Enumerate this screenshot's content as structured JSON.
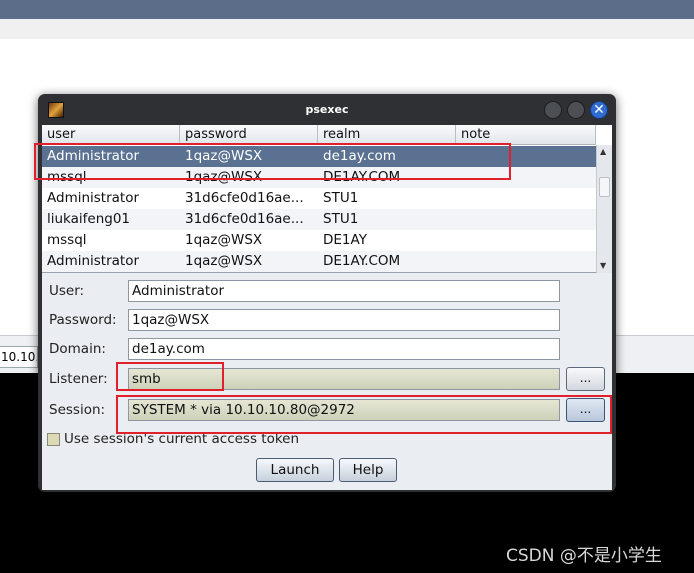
{
  "background": {
    "tab_partial": "10.10.",
    "watermark": "CSDN @不是小学生"
  },
  "dialog": {
    "title": "psexec",
    "close_glyph": "✕",
    "table": {
      "columns": [
        "user",
        "password",
        "realm",
        "note"
      ],
      "rows": [
        {
          "user": "Administrator",
          "password": "1qaz@WSX",
          "realm": "de1ay.com",
          "note": ""
        },
        {
          "user": "mssql",
          "password": "1qaz@WSX",
          "realm": "DE1AY.COM",
          "note": ""
        },
        {
          "user": "Administrator",
          "password": "31d6cfe0d16ae...",
          "realm": "STU1",
          "note": ""
        },
        {
          "user": "liukaifeng01",
          "password": "31d6cfe0d16ae...",
          "realm": "STU1",
          "note": ""
        },
        {
          "user": "mssql",
          "password": "1qaz@WSX",
          "realm": "DE1AY",
          "note": ""
        },
        {
          "user": "Administrator",
          "password": "1qaz@WSX",
          "realm": "DE1AY.COM",
          "note": ""
        }
      ],
      "selected_row": 0
    },
    "form": {
      "user_label": "User:",
      "user_value": "Administrator",
      "password_label": "Password:",
      "password_value": "1qaz@WSX",
      "domain_label": "Domain:",
      "domain_value": "de1ay.com",
      "listener_label": "Listener:",
      "listener_value": "smb",
      "session_label": "Session:",
      "session_value": "SYSTEM * via  10.10.10.80@2972",
      "browse_label": "...",
      "checkbox_label": "Use session's current access token",
      "checkbox_checked": false
    },
    "buttons": {
      "launch": "Launch",
      "help": "Help"
    }
  },
  "colors": {
    "selection": "#5a7192",
    "annotation": "#e0212b"
  }
}
